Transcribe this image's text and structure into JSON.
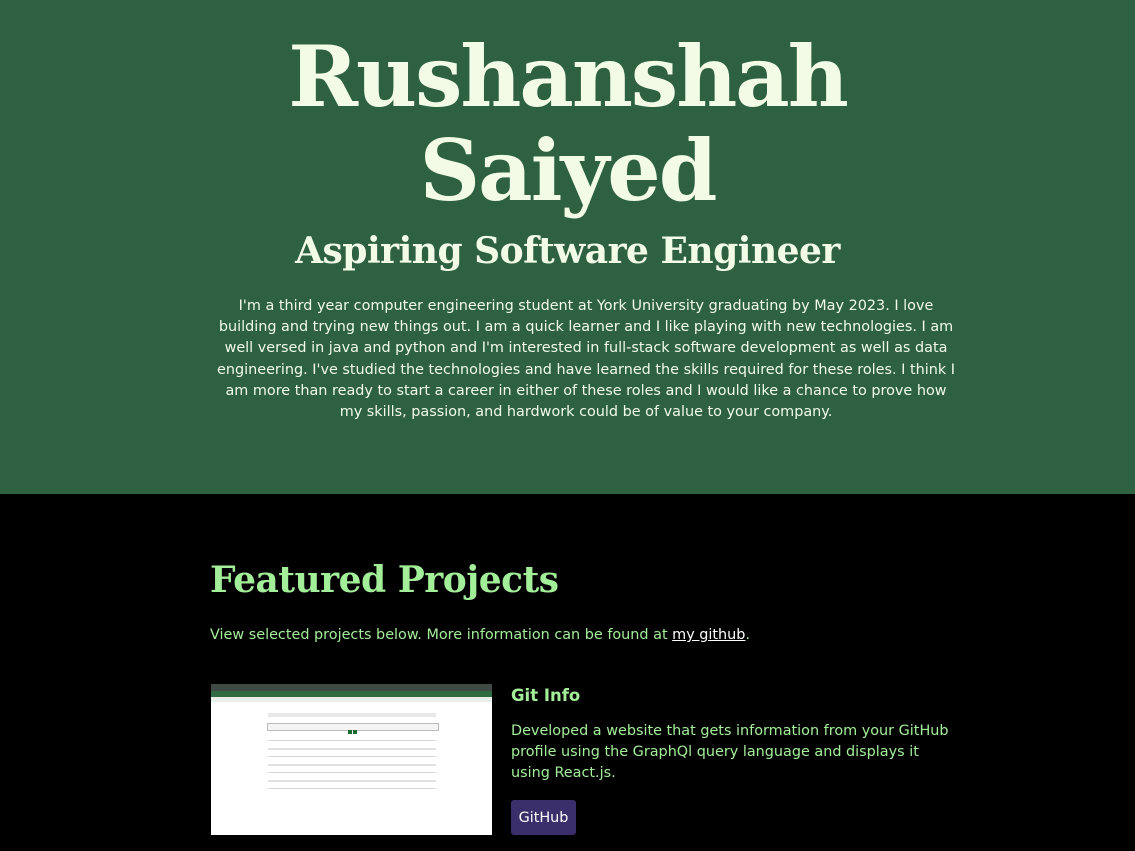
{
  "hero": {
    "name_line1": "Rushanshah",
    "name_line2": "Saiyed",
    "role": "Aspiring Software Engineer",
    "bio": "I'm a third year computer engineering student at York University graduating by May 2023. I love building and trying new things out. I am a quick learner and I like playing with new technologies. I am well versed in java and python and I'm interested in full-stack software development as well as data engineering. I've studied the technologies and have learned the skills required for these roles. I think I am more than ready to start a career in either of these roles and I would like a chance to prove how my skills, passion, and hardwork could be of value to your company."
  },
  "projects": {
    "heading": "Featured Projects",
    "intro_text": "View selected projects below. More information can be found at ",
    "intro_link": "my github",
    "intro_end": ".",
    "items": [
      {
        "title": "Git Info",
        "description": "Developed a website that gets information from your GitHub profile using the GraphQl query language and displays it using React.js.",
        "button_label": "GitHub"
      }
    ]
  },
  "colors": {
    "hero_background": "#2e6140",
    "hero_text": "#f1fbe6",
    "page_background": "#000000",
    "accent_green": "#a3ee99",
    "button_background": "#3a2f6b"
  }
}
